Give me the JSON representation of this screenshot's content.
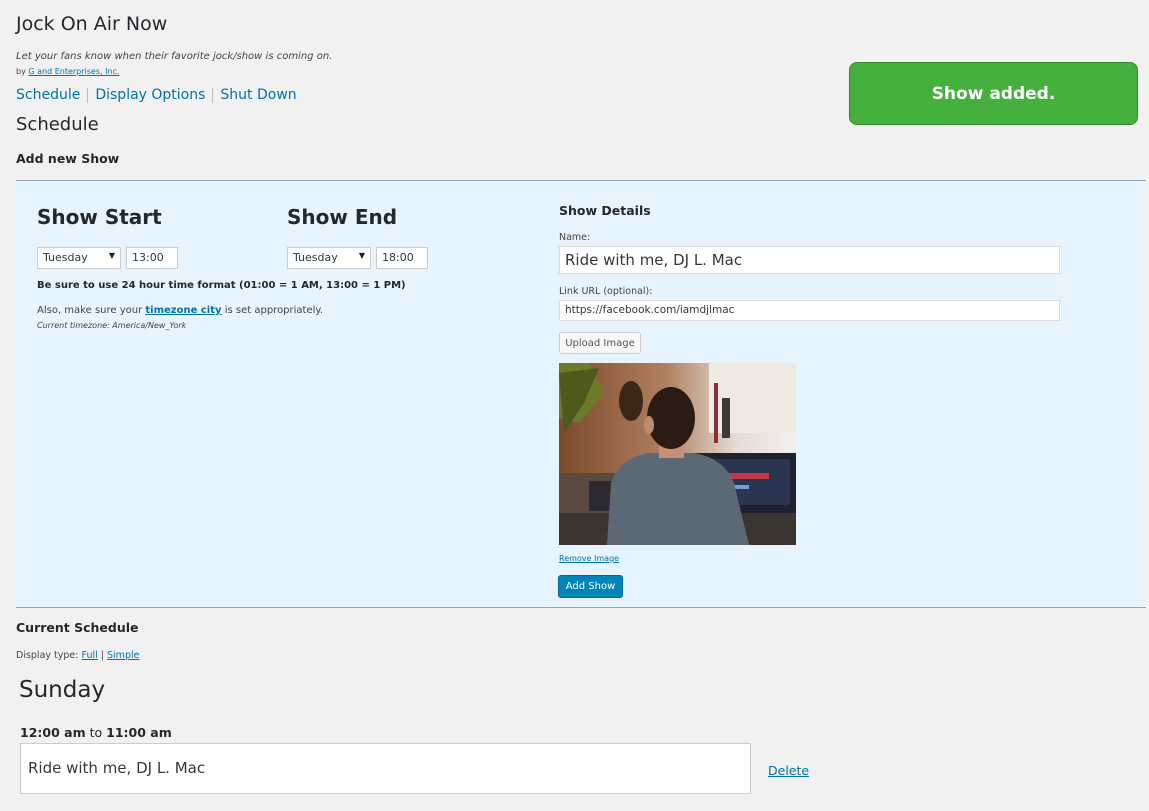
{
  "plugin": {
    "title": "Jock On Air Now",
    "tagline": "Let your fans know when their favorite jock/show is coming on.",
    "by_prefix": "by",
    "author": "G and Enterprises, Inc."
  },
  "nav": {
    "items": [
      "Schedule",
      "Display Options",
      "Shut Down"
    ]
  },
  "notice": {
    "text": "Show added.",
    "color": "#46b03f"
  },
  "page": {
    "heading": "Schedule",
    "add_new_heading": "Add new Show"
  },
  "form": {
    "show_start": {
      "title": "Show Start",
      "day": "Tuesday",
      "time": "13:00"
    },
    "show_end": {
      "title": "Show End",
      "day": "Tuesday",
      "time": "18:00"
    },
    "hint_24h": "Be sure to use 24 hour time format (01:00 = 1 AM, 13:00 = 1 PM)",
    "hint_tz_prefix": "Also, make sure your",
    "hint_tz_link": "timezone city",
    "hint_tz_suffix": "is set appropriately.",
    "current_timezone": "Current timezone: America/New_York",
    "details": {
      "title": "Show Details",
      "name_label": "Name:",
      "name_value": "Ride with me, DJ L. Mac",
      "link_label": "Link URL (optional):",
      "link_value": "https://facebook.com/iamdjlmac",
      "upload_button": "Upload Image",
      "remove_image": "Remove Image",
      "add_button": "Add Show"
    }
  },
  "schedule": {
    "heading": "Current Schedule",
    "display_type_label": "Display type:",
    "display_full": "Full",
    "display_sep": "|",
    "display_simple": "Simple",
    "days": [
      {
        "name": "Sunday",
        "entries": [
          {
            "start": "12:00 am",
            "to": "to",
            "end": "11:00 am",
            "name": "Ride with me, DJ L. Mac",
            "delete": "Delete"
          }
        ]
      }
    ]
  },
  "colors": {
    "accent": "#0073aa",
    "primary_button": "#0085ba",
    "panel_bg": "#e7f3fd",
    "page_bg": "#f1f1f1"
  }
}
